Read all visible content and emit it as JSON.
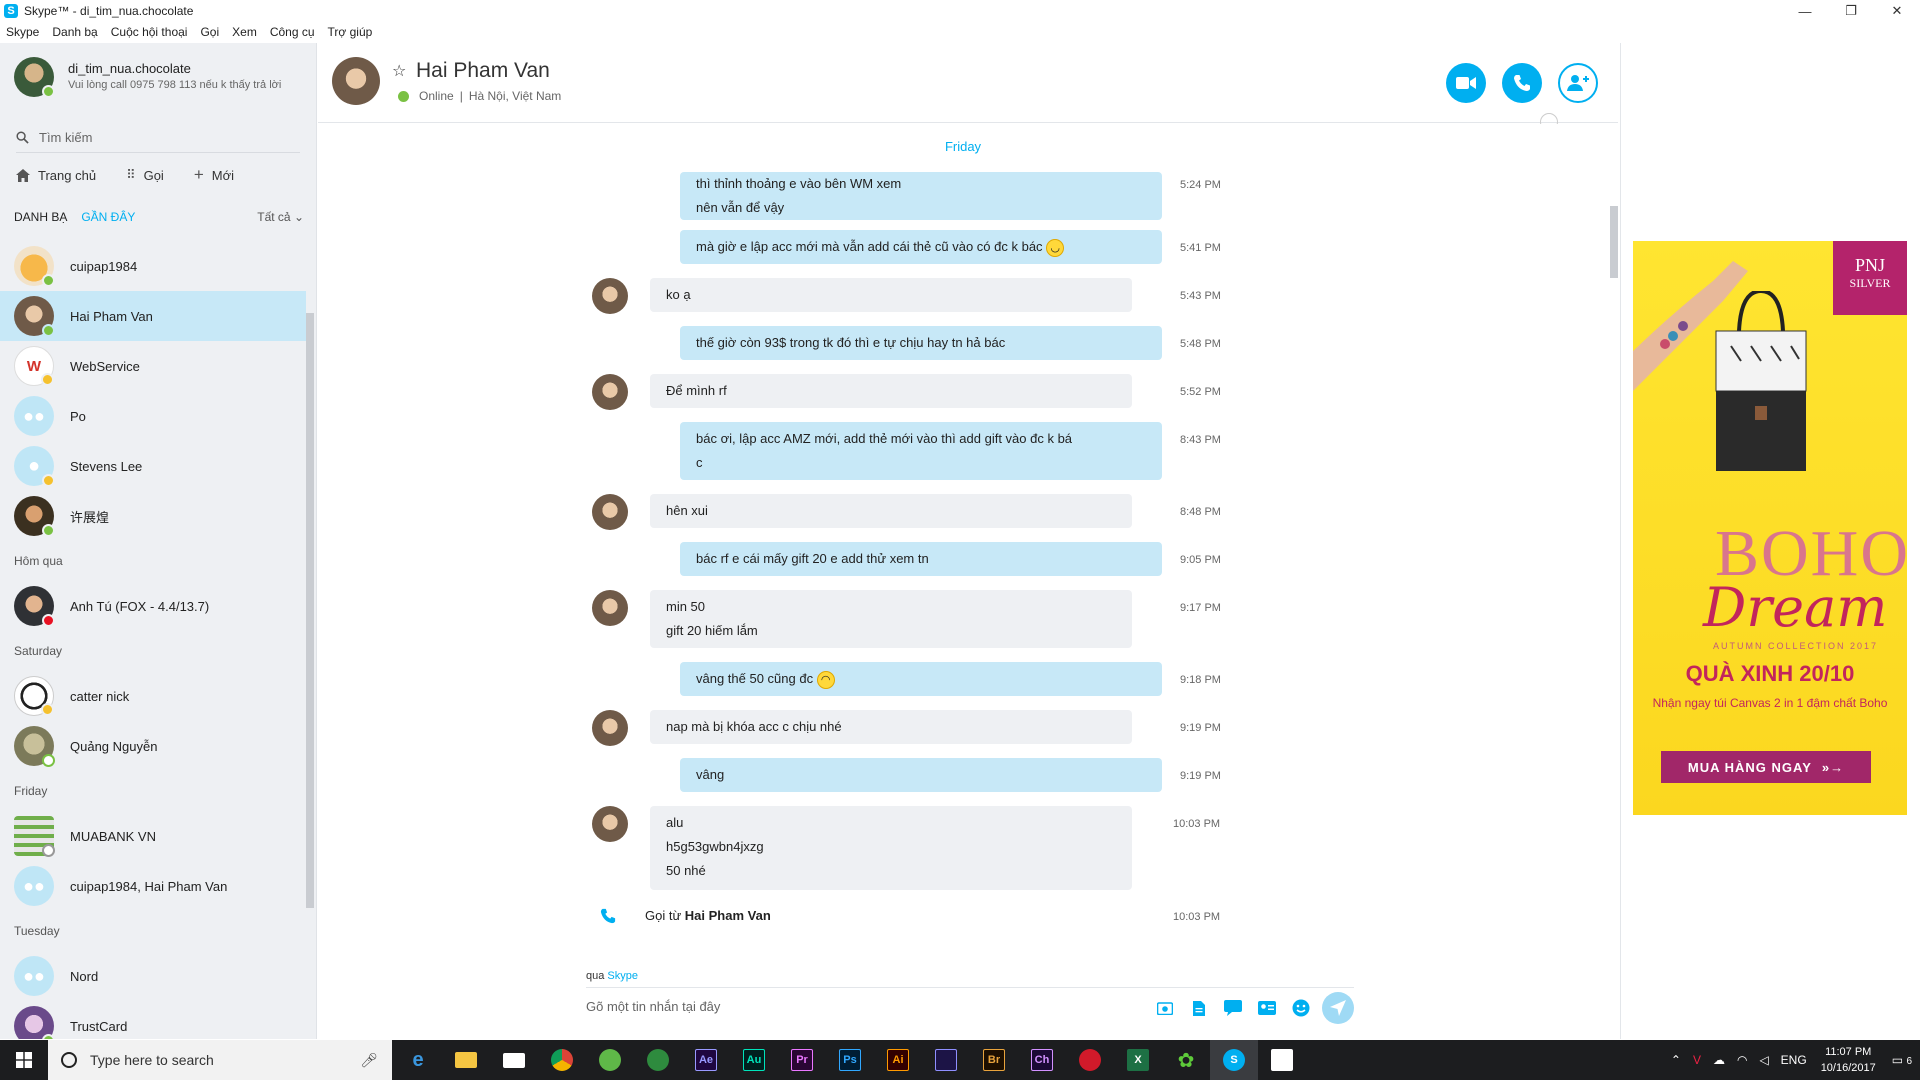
{
  "window": {
    "title": "Skype™ - di_tim_nua.chocolate",
    "controls": [
      "—",
      "❐",
      "✕"
    ]
  },
  "menu": [
    "Skype",
    "Danh bạ",
    "Cuộc hội thoại",
    "Gọi",
    "Xem",
    "Công cụ",
    "Trợ giúp"
  ],
  "profile": {
    "name": "di_tim_nua.chocolate",
    "mood": "Vui lòng call 0975 798 113 nếu k thấy trả lời"
  },
  "search": {
    "placeholder": "Tìm kiếm"
  },
  "nav": {
    "home": "Trang chủ",
    "call": "Gọi",
    "new": "Mới"
  },
  "tabs": {
    "contacts": "DANH BẠ",
    "recent": "GẦN ĐÂY",
    "filter": "Tất cả"
  },
  "contacts": {
    "c0": "cuipap1984",
    "c1": "Hai Pham Van",
    "c2": "WebService",
    "c3": "Po",
    "c4": "Stevens Lee",
    "c5": "许展煌",
    "g_yesterday": "Hôm qua",
    "c6": "Anh Tú (FOX - 4.4/13.7)",
    "g_saturday": "Saturday",
    "c7": "catter nick",
    "c8": "Quảng Nguyễn",
    "g_friday": "Friday",
    "c9": "MUABANK VN",
    "c10": "cuipap1984, Hai Pham Van",
    "g_tuesday": "Tuesday",
    "c11": "Nord",
    "c12": "TrustCard"
  },
  "chat": {
    "name": "Hai Pham Van",
    "status": "Online",
    "separator": "|",
    "location": "Hà Nội, Việt Nam",
    "day": "Friday"
  },
  "messages": {
    "m1": {
      "l1": "thì thỉnh thoảng e vào bên WM xem",
      "l2": "nên vẫn để vậy",
      "time": "5:24 PM"
    },
    "m2": {
      "l1": "mà giờ e lập acc mới mà vẫn add cái thẻ cũ vào có đc k bác",
      "time": "5:41 PM"
    },
    "m3": {
      "l1": "ko ạ",
      "time": "5:43 PM"
    },
    "m4": {
      "l1": "thế giờ còn 93$ trong tk đó thì e tự chịu hay tn hả bác",
      "time": "5:48 PM"
    },
    "m5": {
      "l1": "Để mình rf",
      "time": "5:52 PM"
    },
    "m6": {
      "l1": "bác ơi, lập acc AMZ mới, add thẻ mới vào thì add gift vào đc k bá",
      "l2": "c",
      "time": "8:43 PM"
    },
    "m7": {
      "l1": "hên xui",
      "time": "8:48 PM"
    },
    "m8": {
      "l1": "bác rf e cái mấy gift 20 e add thử xem tn",
      "time": "9:05 PM"
    },
    "m9": {
      "l1": "min 50",
      "l2": "gift 20 hiếm lắm",
      "time": "9:17 PM"
    },
    "m10": {
      "l1": "vâng thế 50 cũng đc",
      "time": "9:18 PM"
    },
    "m11": {
      "l1": "nap mà bị khóa acc c chịu nhé",
      "time": "9:19 PM"
    },
    "m12": {
      "l1": "vâng",
      "time": "9:19 PM"
    },
    "m13": {
      "l1": "alu",
      "l2": "h5g53gwbn4jxzg",
      "l3": "50 nhé",
      "time": "10:03 PM"
    },
    "call": {
      "prefix": "Gọi từ",
      "name": "Hai Pham Van",
      "time": "10:03 PM"
    }
  },
  "compose": {
    "via_prefix": "qua",
    "via": "Skype",
    "placeholder": "Gõ một tin nhắn tại đây"
  },
  "ad": {
    "brand_line1": "PNJ",
    "brand_line2": "SILVER",
    "title1": "BOHO",
    "title2": "Dream",
    "collection": "AUTUMN COLLECTION 2017",
    "headline": "QUÀ XINH 20/10",
    "subline": "Nhận ngay túi Canvas 2 in 1 đậm chất Boho",
    "cta": "MUA HÀNG NGAY",
    "cta_arrow": "»→"
  },
  "taskbar": {
    "search_placeholder": "Type here to search",
    "apps": [
      "Ae",
      "Au",
      "Pr",
      "Ps",
      "Ai",
      "Br",
      "Ch"
    ],
    "lang": "ENG",
    "time": "11:07 PM",
    "date": "10/16/2017",
    "notif_count": "6"
  },
  "colors": {
    "accent": "#00aff0",
    "outgoing": "#c7e8f7",
    "incoming": "#eef0f3",
    "online": "#7ac143",
    "away": "#f5c12e",
    "busy": "#e81123"
  }
}
